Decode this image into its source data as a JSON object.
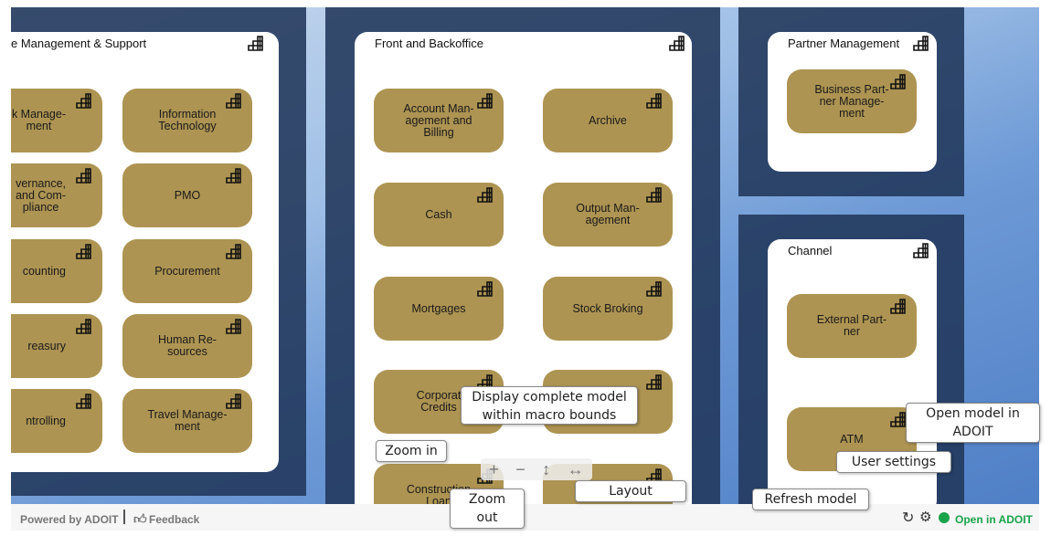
{
  "groups": {
    "left": {
      "title": "e Management & Support",
      "tiles": [
        "k Manage-\nment",
        "Information\nTechnology",
        "vernance,\nand Com-\npliance",
        "PMO",
        "counting",
        "Procurement",
        "reasury",
        "Human Re-\nsources",
        "ntrolling",
        "Travel Manage-\nment"
      ]
    },
    "center": {
      "title": "Front and Backoffice",
      "tiles": [
        "Account Man-\nagement and\nBilling",
        "Archive",
        "Cash",
        "Output Man-\nagement",
        "Mortgages",
        "Stock Broking",
        "Corporat\nCredits",
        "",
        "Construction\nLoan",
        ""
      ]
    },
    "partner": {
      "title": "Partner Management",
      "tiles": [
        "Business Part-\nner Manage-\nment"
      ]
    },
    "channel": {
      "title": "Channel",
      "tiles": [
        "External Part-\nner",
        "ATM"
      ]
    }
  },
  "tooltips": {
    "display_complete": "Display complete model within macro bounds",
    "zoom_in": "Zoom in",
    "zoom_out": "Zoom out",
    "layout": "Layout",
    "refresh": "Refresh model",
    "user_settings": "User settings",
    "open_model": "Open model in ADOIT"
  },
  "controls": {
    "zoom_in": "+",
    "zoom_out": "−",
    "fit_vertical": "↕",
    "fit_horizontal": "↔"
  },
  "footer": {
    "powered": "Powered by ADOIT",
    "feedback": "Feedback",
    "open_in": "Open in ADOIT",
    "refresh_glyph": "↻",
    "settings_glyph": "⚙"
  },
  "colors": {
    "tile": "#ae9452",
    "panel": "#21375a",
    "open_accent": "#1aa34a"
  },
  "icons": {
    "tile": "capability-stairs-icon"
  }
}
